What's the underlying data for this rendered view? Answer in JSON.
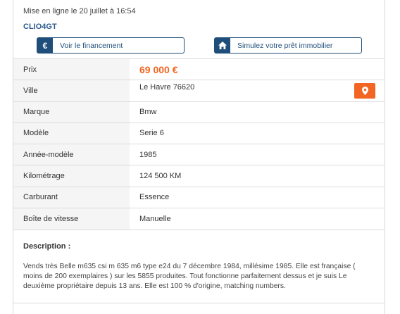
{
  "listing": {
    "published": "Mise en ligne le 20 juillet à 16:54",
    "reference": "CLIO4GT"
  },
  "actions": {
    "financing_label": "Voir le financement",
    "financing_icon": "euro-icon",
    "loan_label": "Simulez votre prêt immobilier",
    "loan_icon": "house-icon"
  },
  "specs": [
    {
      "label": "Prix",
      "value": "69 000 €"
    },
    {
      "label": "Ville",
      "value": "Le Havre 76620"
    },
    {
      "label": "Marque",
      "value": "Bmw"
    },
    {
      "label": "Modèle",
      "value": "Serie 6"
    },
    {
      "label": "Année-modèle",
      "value": "1985"
    },
    {
      "label": "Kilométrage",
      "value": "124 500 KM"
    },
    {
      "label": "Carburant",
      "value": "Essence"
    },
    {
      "label": "Boîte de vitesse",
      "value": "Manuelle"
    }
  ],
  "location_button_icon": "map-pin-icon",
  "description": {
    "title": "Description :",
    "text": "Vends très Belle m635 csi m 635 m6 type e24 du 7 décembre 1984, millésime 1985. Elle est française ( moins de 200 exemplaires ) sur les 5855 produites. Tout fonctionne parfaitement dessus et je suis Le deuxième propriétaire depuis 13 ans. Elle est 100 % d'origine, matching numbers."
  },
  "colors": {
    "accent": "#f26522",
    "brand": "#1f4e7a"
  }
}
